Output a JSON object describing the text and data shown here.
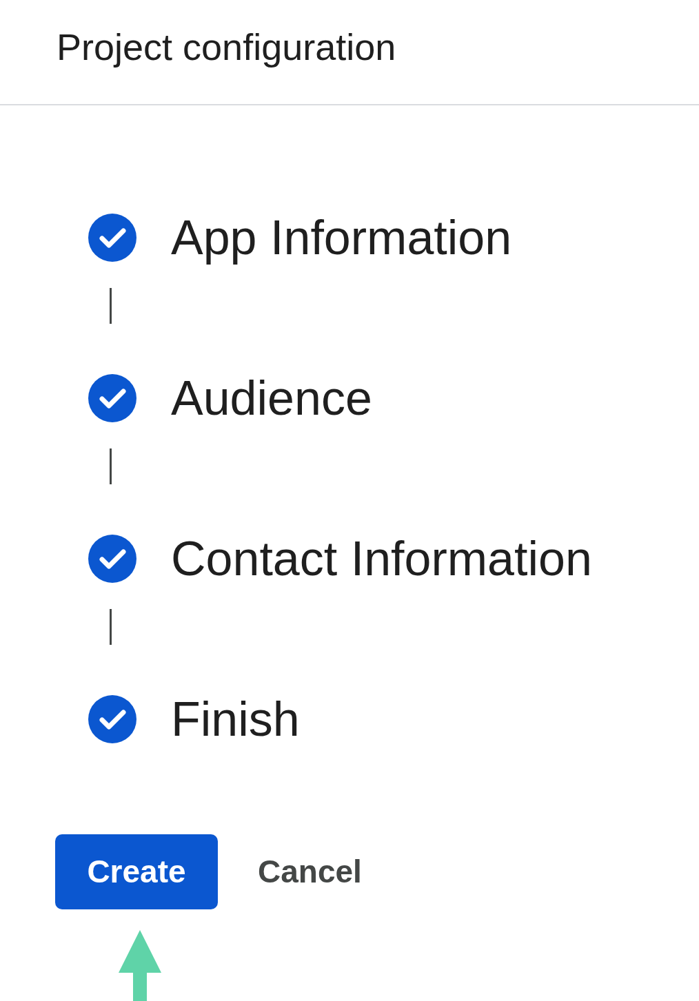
{
  "header": {
    "title": "Project configuration"
  },
  "steps": [
    {
      "label": "App Information",
      "completed": true
    },
    {
      "label": "Audience",
      "completed": true
    },
    {
      "label": "Contact Information",
      "completed": true
    },
    {
      "label": "Finish",
      "completed": true
    }
  ],
  "buttons": [
    {
      "label": "Create",
      "kind": "primary"
    },
    {
      "label": "Cancel",
      "kind": "text"
    }
  ]
}
